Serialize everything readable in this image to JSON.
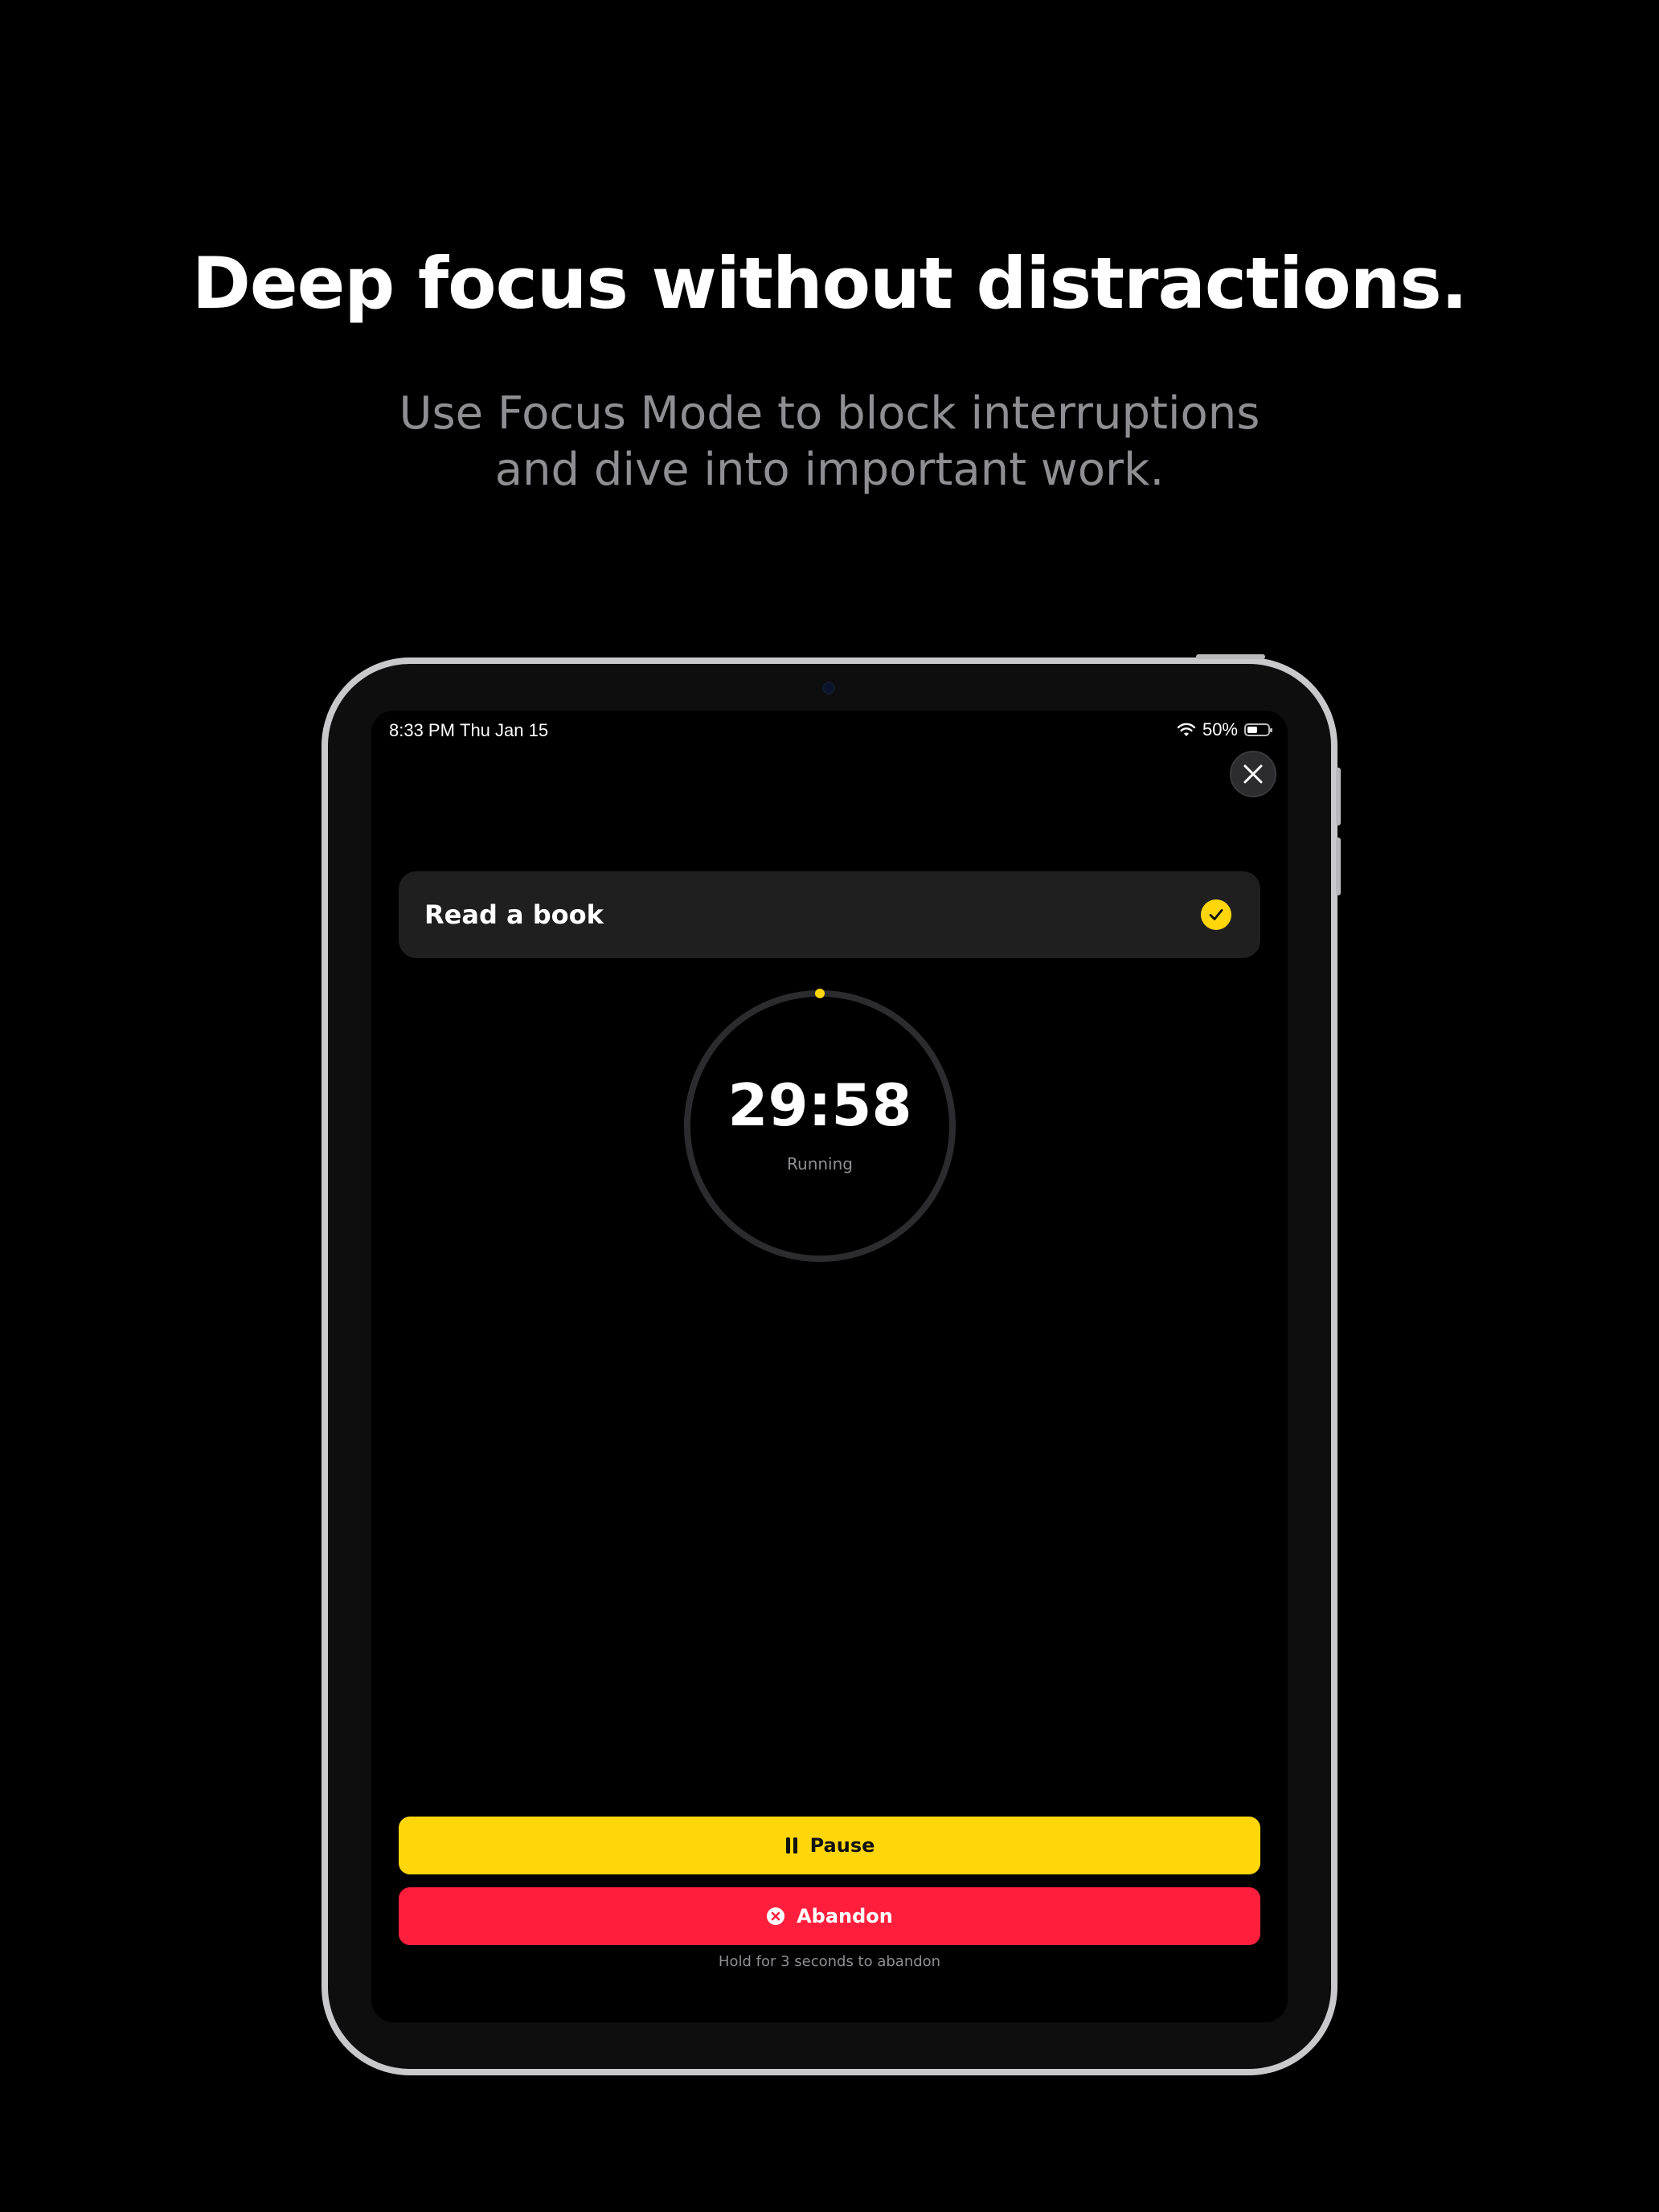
{
  "hero": {
    "headline": "Deep focus without distractions.",
    "subline_1": "Use Focus Mode to block interruptions",
    "subline_2": "and dive into important work."
  },
  "status_bar": {
    "time": "8:33 PM",
    "date": "Thu Jan 15",
    "battery": "50%"
  },
  "task": {
    "title": "Read a book",
    "completed": true
  },
  "timer": {
    "value": "29:58",
    "status": "Running"
  },
  "actions": {
    "pause_label": "Pause",
    "abandon_label": "Abandon",
    "hint": "Hold for 3 seconds to abandon"
  },
  "colors": {
    "accent": "#ffd60a",
    "danger": "#ff1f3d",
    "card": "#1f1f1f",
    "secondary_text": "#8e8e93"
  }
}
